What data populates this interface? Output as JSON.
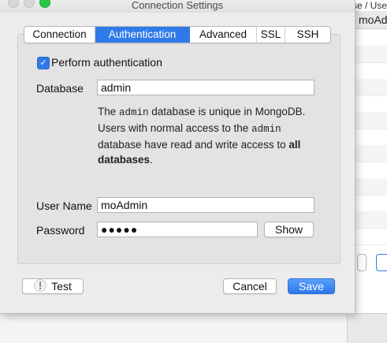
{
  "background_app": {
    "breadcrumb": "se / Use",
    "header_text": "moAd"
  },
  "window": {
    "title": "Connection Settings"
  },
  "tabs": [
    {
      "label": "Connection",
      "active": false
    },
    {
      "label": "Authentication",
      "active": true
    },
    {
      "label": "Advanced",
      "active": false
    },
    {
      "label": "SSL",
      "active": false
    },
    {
      "label": "SSH",
      "active": false
    }
  ],
  "auth": {
    "perform_label": "Perform authentication",
    "perform_checked": true,
    "database_label": "Database",
    "database_value": "admin",
    "note": {
      "p1": "The ",
      "code1": "admin",
      "p2": " database is unique in MongoDB. Users with normal access to the ",
      "code2": "admin",
      "p3": " database have read and write access to ",
      "bold": "all databases",
      "p4": "."
    },
    "username_label": "User Name",
    "username_value": "moAdmin",
    "password_label": "Password",
    "password_value": "●●●●●",
    "show_label": "Show"
  },
  "footer": {
    "test_label": "Test",
    "cancel_label": "Cancel",
    "save_label": "Save"
  },
  "colors": {
    "accent": "#2f7ae8",
    "window_bg": "#ececec",
    "panel_bg": "#e3e3e3"
  }
}
